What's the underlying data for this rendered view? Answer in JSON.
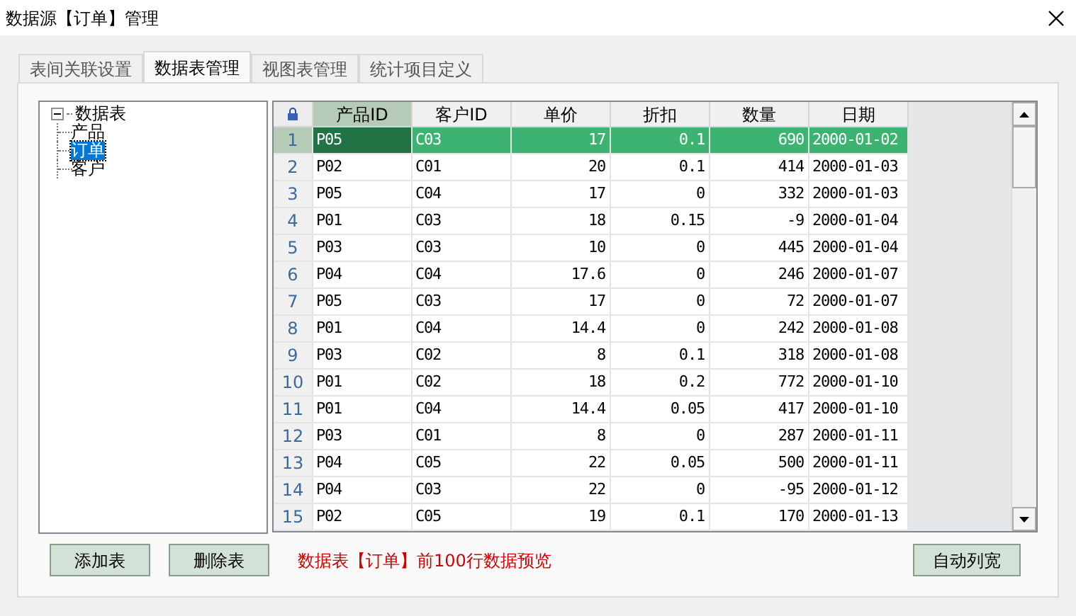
{
  "window": {
    "title": "数据源【订单】管理"
  },
  "tabs": [
    {
      "label": "表间关联设置",
      "selected": false
    },
    {
      "label": "数据表管理",
      "selected": true
    },
    {
      "label": "视图表管理",
      "selected": false
    },
    {
      "label": "统计项目定义",
      "selected": false
    }
  ],
  "tree": {
    "label": "数据表",
    "expanded": true,
    "children": [
      {
        "label": "产品",
        "selected": false
      },
      {
        "label": "订单",
        "selected": true
      },
      {
        "label": "客户",
        "selected": false
      }
    ]
  },
  "table": {
    "columns": [
      {
        "label": "产品ID",
        "kind": "text",
        "selected": true
      },
      {
        "label": "客户ID",
        "kind": "text",
        "selected": false
      },
      {
        "label": "单价",
        "kind": "number",
        "selected": false
      },
      {
        "label": "折扣",
        "kind": "number",
        "selected": false
      },
      {
        "label": "数量",
        "kind": "number",
        "selected": false
      },
      {
        "label": "日期",
        "kind": "text",
        "selected": false
      }
    ],
    "rows": [
      {
        "number": "1",
        "selected": true,
        "cells": [
          "P05",
          "C03",
          "17",
          "0.1",
          "690",
          "2000-01-02"
        ]
      },
      {
        "number": "2",
        "selected": false,
        "cells": [
          "P02",
          "C01",
          "20",
          "0.1",
          "414",
          "2000-01-03"
        ]
      },
      {
        "number": "3",
        "selected": false,
        "cells": [
          "P05",
          "C04",
          "17",
          "0",
          "332",
          "2000-01-03"
        ]
      },
      {
        "number": "4",
        "selected": false,
        "cells": [
          "P01",
          "C03",
          "18",
          "0.15",
          "-9",
          "2000-01-04"
        ]
      },
      {
        "number": "5",
        "selected": false,
        "cells": [
          "P03",
          "C03",
          "10",
          "0",
          "445",
          "2000-01-04"
        ]
      },
      {
        "number": "6",
        "selected": false,
        "cells": [
          "P04",
          "C04",
          "17.6",
          "0",
          "246",
          "2000-01-07"
        ]
      },
      {
        "number": "7",
        "selected": false,
        "cells": [
          "P05",
          "C03",
          "17",
          "0",
          "72",
          "2000-01-07"
        ]
      },
      {
        "number": "8",
        "selected": false,
        "cells": [
          "P01",
          "C04",
          "14.4",
          "0",
          "242",
          "2000-01-08"
        ]
      },
      {
        "number": "9",
        "selected": false,
        "cells": [
          "P03",
          "C02",
          "8",
          "0.1",
          "318",
          "2000-01-08"
        ]
      },
      {
        "number": "10",
        "selected": false,
        "cells": [
          "P01",
          "C02",
          "18",
          "0.2",
          "772",
          "2000-01-10"
        ]
      },
      {
        "number": "11",
        "selected": false,
        "cells": [
          "P01",
          "C04",
          "14.4",
          "0.05",
          "417",
          "2000-01-10"
        ]
      },
      {
        "number": "12",
        "selected": false,
        "cells": [
          "P03",
          "C01",
          "8",
          "0",
          "287",
          "2000-01-11"
        ]
      },
      {
        "number": "13",
        "selected": false,
        "cells": [
          "P04",
          "C05",
          "22",
          "0.05",
          "500",
          "2000-01-11"
        ]
      },
      {
        "number": "14",
        "selected": false,
        "cells": [
          "P04",
          "C03",
          "22",
          "0",
          "-95",
          "2000-01-12"
        ]
      },
      {
        "number": "15",
        "selected": false,
        "cells": [
          "P02",
          "C05",
          "19",
          "0.1",
          "170",
          "2000-01-13"
        ]
      }
    ]
  },
  "buttons": [
    "添加表",
    "删除表"
  ],
  "preview_note": "数据表【订单】前100行数据预览",
  "auto_width_button": "自动列宽"
}
